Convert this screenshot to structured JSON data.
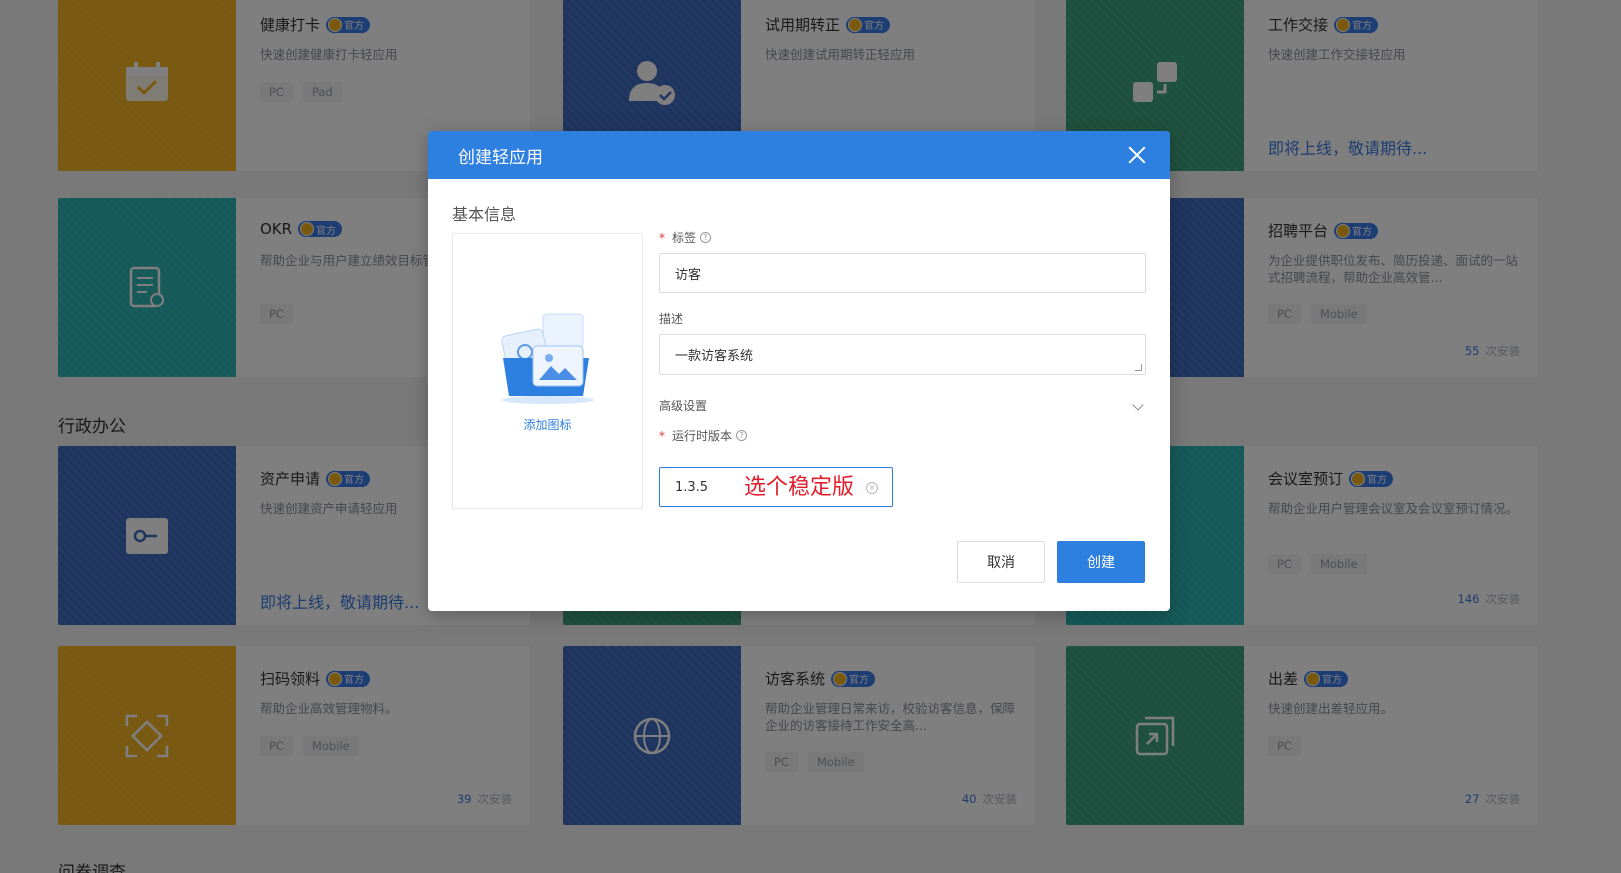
{
  "background": {
    "sections": [
      "行政办公",
      "问卷调查"
    ],
    "cards": [
      {
        "title": "健康打卡",
        "badge": "官方",
        "desc": "快速创建健康打卡轻应用",
        "tags": [
          "PC",
          "Pad"
        ],
        "installs": "",
        "soon": ""
      },
      {
        "title": "试用期转正",
        "badge": "官方",
        "desc": "快速创建试用期转正轻应用",
        "tags": [],
        "installs": "",
        "soon": ""
      },
      {
        "title": "工作交接",
        "badge": "官方",
        "desc": "快速创建工作交接轻应用",
        "tags": [],
        "installs": "",
        "soon": "即将上线，敬请期待..."
      },
      {
        "title": "OKR",
        "badge": "官方",
        "desc": "帮助企业与用户建立绩效目标管理。",
        "tags": [
          "PC"
        ],
        "installs": "",
        "soon": ""
      },
      {
        "title": "招聘平台",
        "badge": "官方",
        "desc": "为企业提供职位发布、简历投递、面试的一站式招聘流程，帮助企业高效管...",
        "tags": [
          "PC",
          "Mobile"
        ],
        "installs": "55",
        "soon": ""
      },
      {
        "title": "资产申请",
        "badge": "官方",
        "desc": "快速创建资产申请轻应用",
        "tags": [],
        "installs": "",
        "soon": "即将上线，敬请期待..."
      },
      {
        "title": "会议室预订",
        "badge": "官方",
        "desc": "帮助企业用户管理会议室及会议室预订情况。",
        "tags": [
          "PC",
          "Mobile"
        ],
        "installs": "146",
        "soon": ""
      },
      {
        "title": "扫码领料",
        "badge": "官方",
        "desc": "帮助企业高效管理物料。",
        "tags": [
          "PC",
          "Mobile"
        ],
        "installs": "39",
        "soon": ""
      },
      {
        "title": "访客系统",
        "badge": "官方",
        "desc": "帮助企业管理日常来访，校验访客信息，保障企业的访客接待工作安全高...",
        "tags": [
          "PC",
          "Mobile"
        ],
        "installs": "40",
        "soon": ""
      },
      {
        "title": "出差",
        "badge": "官方",
        "desc": "快速创建出差轻应用。",
        "tags": [
          "PC"
        ],
        "installs": "27",
        "soon": ""
      }
    ],
    "installs_suffix": "次安装"
  },
  "modal": {
    "title": "创建轻应用",
    "section_label": "基本信息",
    "add_icon_label": "添加图标",
    "tag_label": "标签",
    "tag_value": "访客",
    "desc_label": "描述",
    "desc_value": "一款访客系统",
    "advanced_label": "高级设置",
    "runtime_label": "运行时版本",
    "runtime_value": "1.3.5",
    "annotation": "选个稳定版",
    "cancel_label": "取消",
    "create_label": "创建"
  },
  "colors": {
    "primary": "#2d7fe0",
    "annotation": "#e21d2b",
    "overlay": "rgba(0,0,0,0.5)"
  }
}
